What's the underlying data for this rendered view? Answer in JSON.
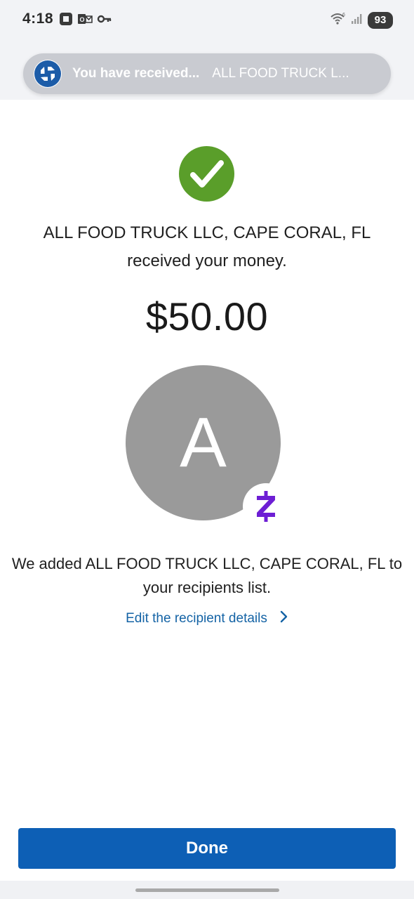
{
  "status_bar": {
    "time": "4:18",
    "battery": "93",
    "left_icons": [
      "bank-app-icon",
      "outlook-icon",
      "key-icon"
    ],
    "right_icons": [
      "wifi-icon",
      "signal-icon"
    ]
  },
  "notification": {
    "title": "You have received...",
    "body": "ALL FOOD TRUCK L..."
  },
  "confirmation": {
    "recipient_line1": "ALL FOOD TRUCK LLC, CAPE CORAL, FL",
    "recipient_line2": "received your money.",
    "amount": "$50.00",
    "avatar_initial": "A",
    "added_line1": "We added ALL FOOD TRUCK LLC, CAPE CORAL, FL to",
    "added_line2": "your recipients list.",
    "edit_link": "Edit the recipient details"
  },
  "actions": {
    "done": "Done"
  },
  "colors": {
    "accent": "#0d5fb5",
    "success": "#5a9e2a",
    "zelle": "#6d1ed4",
    "link": "#1463a5"
  }
}
